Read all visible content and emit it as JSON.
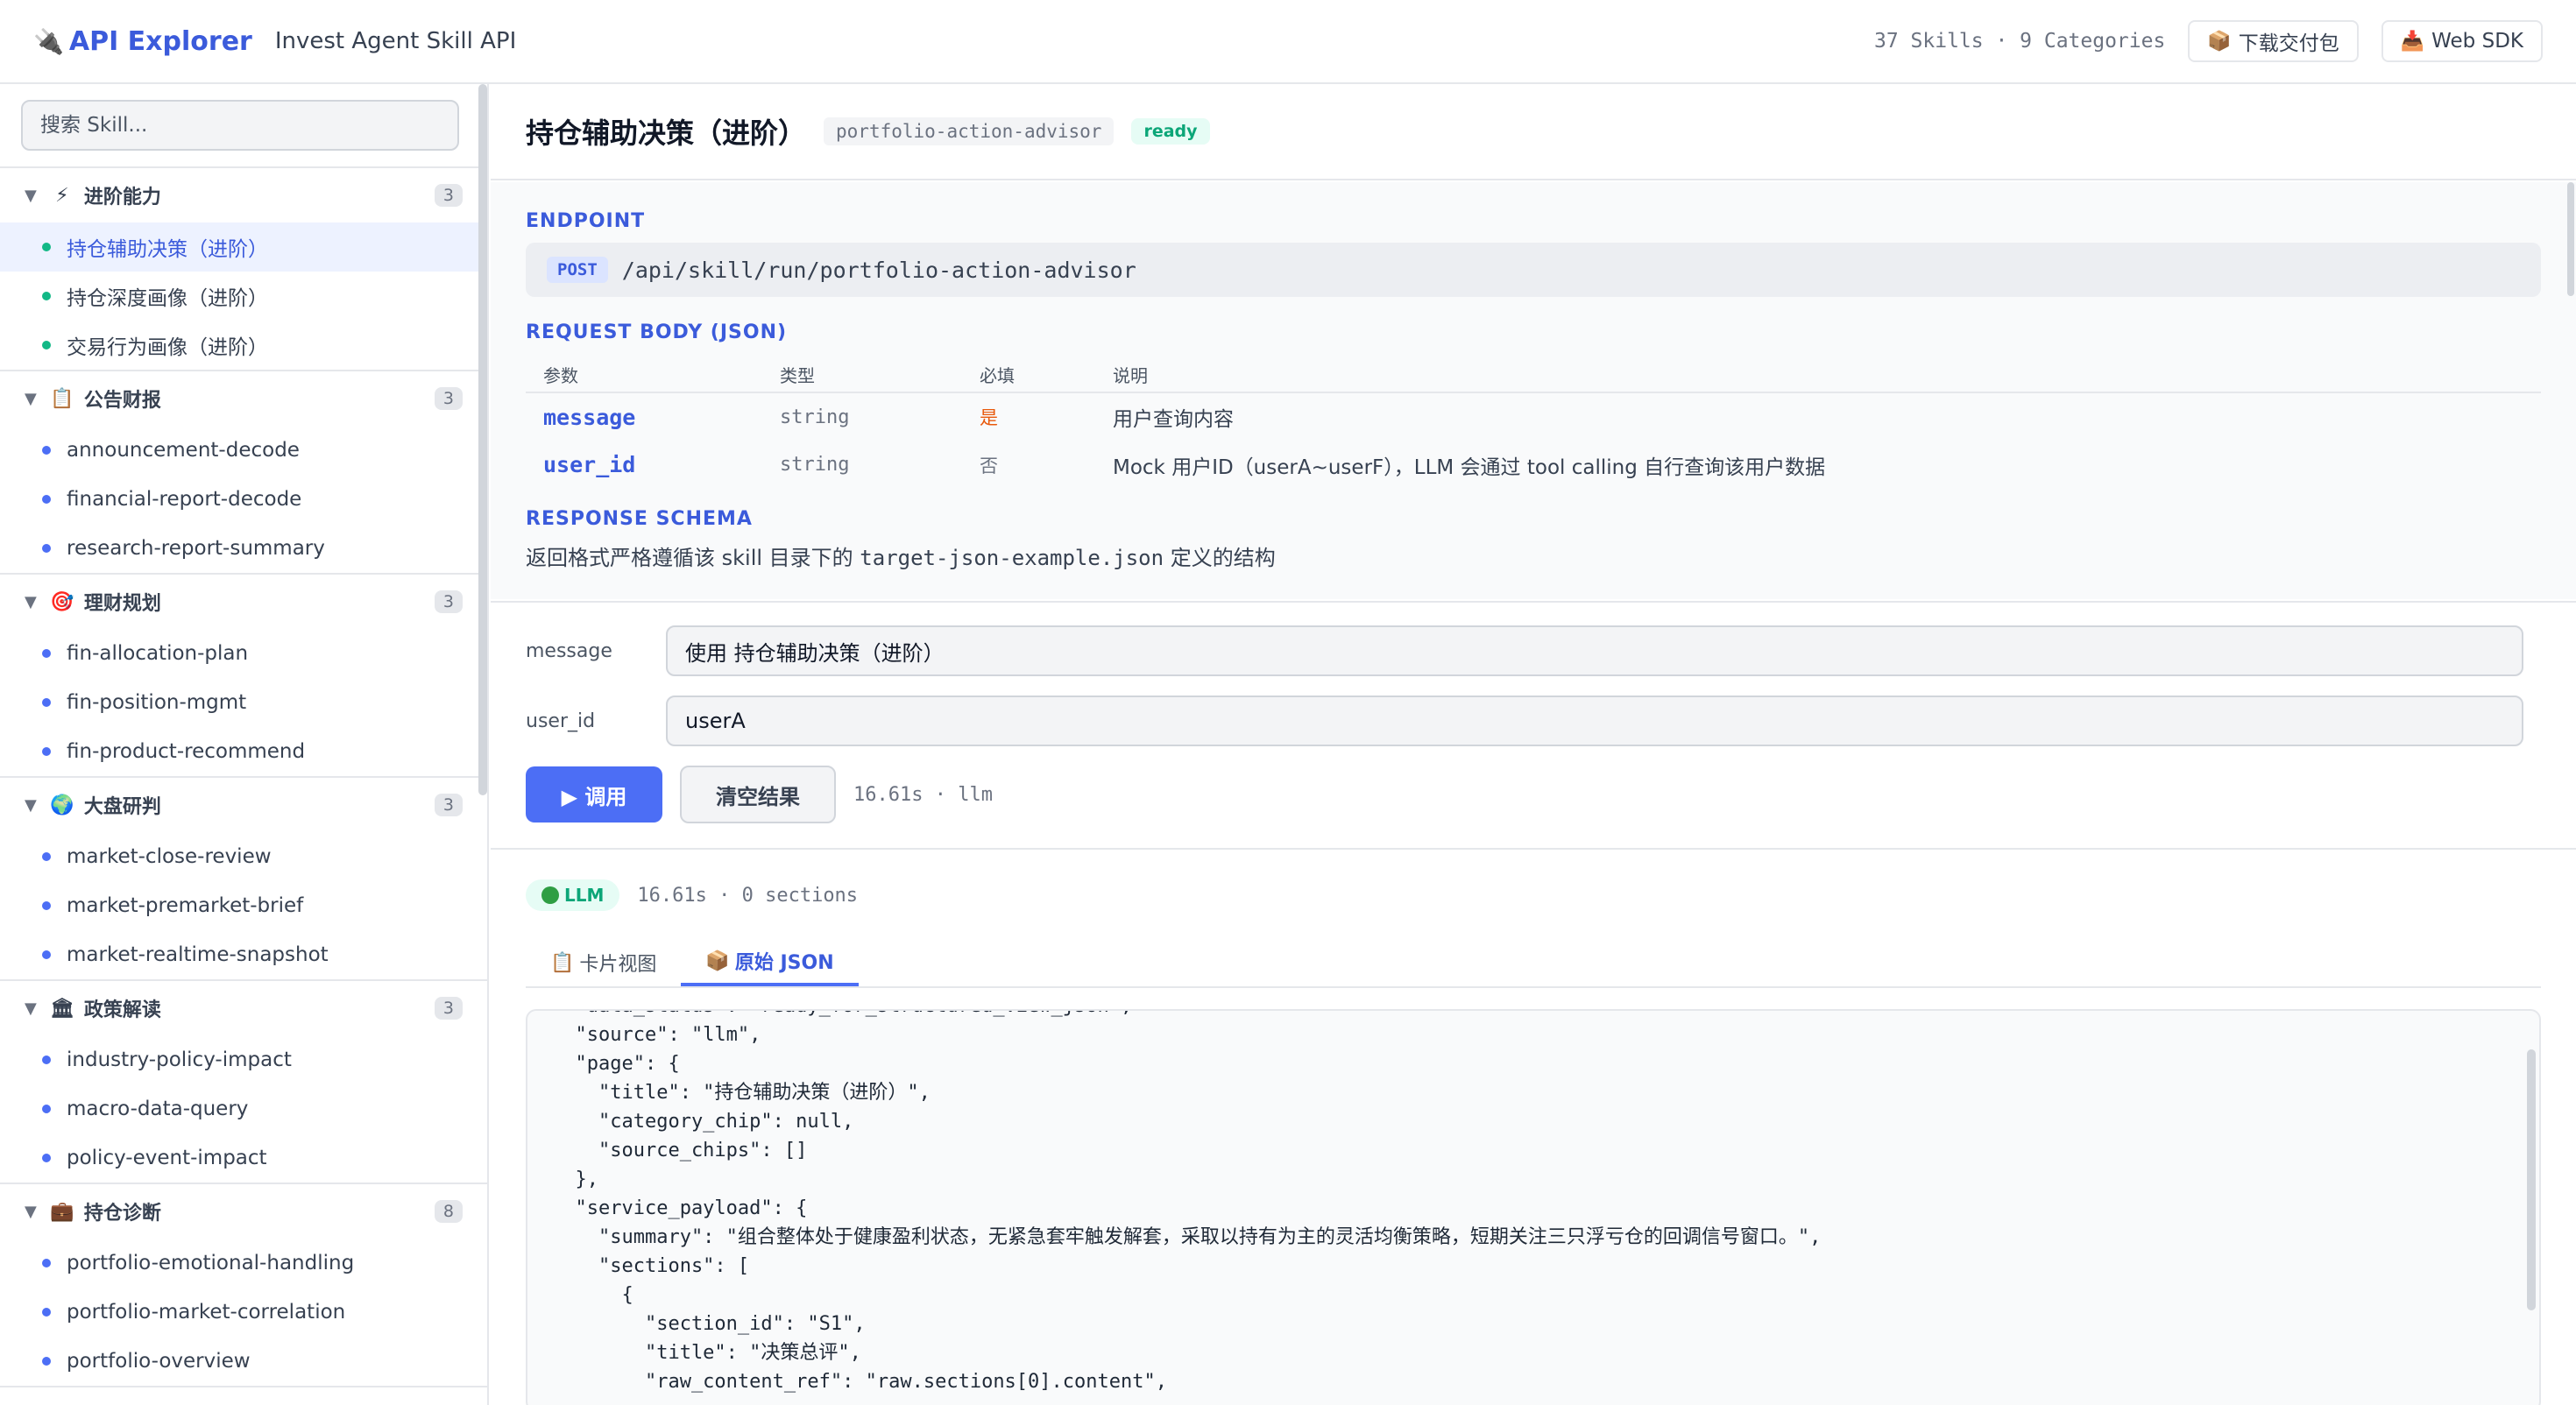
{
  "header": {
    "brand": "API Explorer",
    "subtitle": "Invest Agent Skill API",
    "stats": "37 Skills · 9 Categories",
    "download_label": "下载交付包",
    "sdk_label": "Web SDK"
  },
  "sidebar": {
    "search_placeholder": "搜索 Skill...",
    "categories": [
      {
        "caret": "▼",
        "emoji": "⚡",
        "name": "进阶能力",
        "count": "3",
        "items": [
          "持仓辅助决策（进阶）",
          "持仓深度画像（进阶）",
          "交易行为画像（进阶）"
        ]
      },
      {
        "caret": "▼",
        "emoji": "📋",
        "name": "公告财报",
        "count": "3",
        "items": [
          "announcement-decode",
          "financial-report-decode",
          "research-report-summary"
        ]
      },
      {
        "caret": "▼",
        "emoji": "🎯",
        "name": "理财规划",
        "count": "3",
        "items": [
          "fin-allocation-plan",
          "fin-position-mgmt",
          "fin-product-recommend"
        ]
      },
      {
        "caret": "▼",
        "emoji": "🌍",
        "name": "大盘研判",
        "count": "3",
        "items": [
          "market-close-review",
          "market-premarket-brief",
          "market-realtime-snapshot"
        ]
      },
      {
        "caret": "▼",
        "emoji": "🏛",
        "name": "政策解读",
        "count": "3",
        "items": [
          "industry-policy-impact",
          "macro-data-query",
          "policy-event-impact"
        ]
      },
      {
        "caret": "▼",
        "emoji": "💼",
        "name": "持仓诊断",
        "count": "8",
        "items": [
          "portfolio-emotional-handling",
          "portfolio-market-correlation",
          "portfolio-overview"
        ]
      }
    ]
  },
  "skill": {
    "title": "持仓辅助决策（进阶）",
    "slug": "portfolio-action-advisor",
    "status": "ready"
  },
  "doc": {
    "endpoint_label": "ENDPOINT",
    "method": "POST",
    "path": "/api/skill/run/portfolio-action-advisor",
    "request_label": "REQUEST BODY (JSON)",
    "columns": [
      "参数",
      "类型",
      "必填",
      "说明"
    ],
    "params": [
      {
        "name": "message",
        "type": "string",
        "required": "是",
        "desc": "用户查询内容"
      },
      {
        "name": "user_id",
        "type": "string",
        "required": "否",
        "desc": "Mock 用户ID（userA~userF），LLM 会通过 tool calling 自行查询该用户数据"
      }
    ],
    "response_label": "RESPONSE SCHEMA",
    "schema_note_pre": "返回格式严格遵循该 skill 目录下的 ",
    "schema_note_code": "target-json-example.json",
    "schema_note_post": " 定义的结构"
  },
  "form": {
    "message_label": "message",
    "message_value": "使用 持仓辅助决策（进阶）",
    "user_label": "user_id",
    "user_value": "userA",
    "invoke_label": "▶ 调用",
    "clear_label": "清空结果",
    "timing": "16.61s · llm"
  },
  "result": {
    "badge": "LLM",
    "meta": "16.61s · 0 sections",
    "tab_card": "卡片视图",
    "tab_json": "原始 JSON",
    "json_lines": [
      "  \"data_status\": \"ready_for_structured_view_json\",",
      "  \"source\": \"llm\",",
      "  \"page\": {",
      "    \"title\": \"持仓辅助决策（进阶）\",",
      "    \"category_chip\": null,",
      "    \"source_chips\": []",
      "  },",
      "  \"service_payload\": {",
      "    \"summary\": \"组合整体处于健康盈利状态，无紧急套牢触发解套，采取以持有为主的灵活均衡策略，短期关注三只浮亏仓的回调信号窗口。\",",
      "    \"sections\": [",
      "      {",
      "        \"section_id\": \"S1\",",
      "        \"title\": \"决策总评\",",
      "        \"raw_content_ref\": \"raw.sections[0].content\","
    ]
  }
}
